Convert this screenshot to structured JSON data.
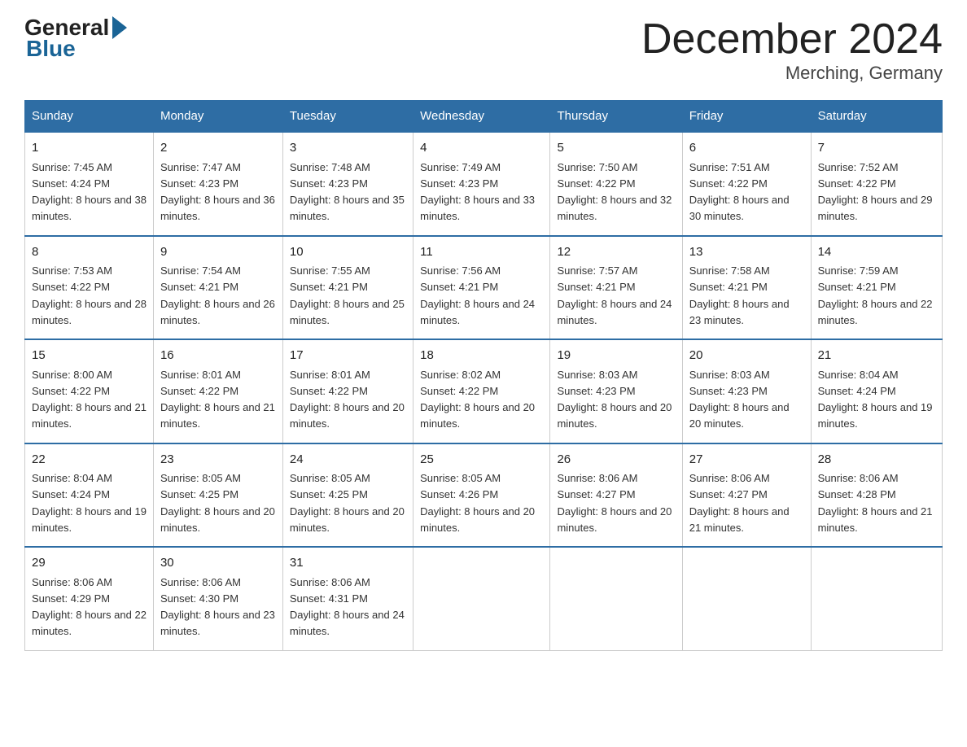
{
  "logo": {
    "general": "General",
    "blue": "Blue"
  },
  "title": "December 2024",
  "subtitle": "Merching, Germany",
  "days_of_week": [
    "Sunday",
    "Monday",
    "Tuesday",
    "Wednesday",
    "Thursday",
    "Friday",
    "Saturday"
  ],
  "weeks": [
    [
      {
        "num": "1",
        "sunrise": "7:45 AM",
        "sunset": "4:24 PM",
        "daylight": "8 hours and 38 minutes."
      },
      {
        "num": "2",
        "sunrise": "7:47 AM",
        "sunset": "4:23 PM",
        "daylight": "8 hours and 36 minutes."
      },
      {
        "num": "3",
        "sunrise": "7:48 AM",
        "sunset": "4:23 PM",
        "daylight": "8 hours and 35 minutes."
      },
      {
        "num": "4",
        "sunrise": "7:49 AM",
        "sunset": "4:23 PM",
        "daylight": "8 hours and 33 minutes."
      },
      {
        "num": "5",
        "sunrise": "7:50 AM",
        "sunset": "4:22 PM",
        "daylight": "8 hours and 32 minutes."
      },
      {
        "num": "6",
        "sunrise": "7:51 AM",
        "sunset": "4:22 PM",
        "daylight": "8 hours and 30 minutes."
      },
      {
        "num": "7",
        "sunrise": "7:52 AM",
        "sunset": "4:22 PM",
        "daylight": "8 hours and 29 minutes."
      }
    ],
    [
      {
        "num": "8",
        "sunrise": "7:53 AM",
        "sunset": "4:22 PM",
        "daylight": "8 hours and 28 minutes."
      },
      {
        "num": "9",
        "sunrise": "7:54 AM",
        "sunset": "4:21 PM",
        "daylight": "8 hours and 26 minutes."
      },
      {
        "num": "10",
        "sunrise": "7:55 AM",
        "sunset": "4:21 PM",
        "daylight": "8 hours and 25 minutes."
      },
      {
        "num": "11",
        "sunrise": "7:56 AM",
        "sunset": "4:21 PM",
        "daylight": "8 hours and 24 minutes."
      },
      {
        "num": "12",
        "sunrise": "7:57 AM",
        "sunset": "4:21 PM",
        "daylight": "8 hours and 24 minutes."
      },
      {
        "num": "13",
        "sunrise": "7:58 AM",
        "sunset": "4:21 PM",
        "daylight": "8 hours and 23 minutes."
      },
      {
        "num": "14",
        "sunrise": "7:59 AM",
        "sunset": "4:21 PM",
        "daylight": "8 hours and 22 minutes."
      }
    ],
    [
      {
        "num": "15",
        "sunrise": "8:00 AM",
        "sunset": "4:22 PM",
        "daylight": "8 hours and 21 minutes."
      },
      {
        "num": "16",
        "sunrise": "8:01 AM",
        "sunset": "4:22 PM",
        "daylight": "8 hours and 21 minutes."
      },
      {
        "num": "17",
        "sunrise": "8:01 AM",
        "sunset": "4:22 PM",
        "daylight": "8 hours and 20 minutes."
      },
      {
        "num": "18",
        "sunrise": "8:02 AM",
        "sunset": "4:22 PM",
        "daylight": "8 hours and 20 minutes."
      },
      {
        "num": "19",
        "sunrise": "8:03 AM",
        "sunset": "4:23 PM",
        "daylight": "8 hours and 20 minutes."
      },
      {
        "num": "20",
        "sunrise": "8:03 AM",
        "sunset": "4:23 PM",
        "daylight": "8 hours and 20 minutes."
      },
      {
        "num": "21",
        "sunrise": "8:04 AM",
        "sunset": "4:24 PM",
        "daylight": "8 hours and 19 minutes."
      }
    ],
    [
      {
        "num": "22",
        "sunrise": "8:04 AM",
        "sunset": "4:24 PM",
        "daylight": "8 hours and 19 minutes."
      },
      {
        "num": "23",
        "sunrise": "8:05 AM",
        "sunset": "4:25 PM",
        "daylight": "8 hours and 20 minutes."
      },
      {
        "num": "24",
        "sunrise": "8:05 AM",
        "sunset": "4:25 PM",
        "daylight": "8 hours and 20 minutes."
      },
      {
        "num": "25",
        "sunrise": "8:05 AM",
        "sunset": "4:26 PM",
        "daylight": "8 hours and 20 minutes."
      },
      {
        "num": "26",
        "sunrise": "8:06 AM",
        "sunset": "4:27 PM",
        "daylight": "8 hours and 20 minutes."
      },
      {
        "num": "27",
        "sunrise": "8:06 AM",
        "sunset": "4:27 PM",
        "daylight": "8 hours and 21 minutes."
      },
      {
        "num": "28",
        "sunrise": "8:06 AM",
        "sunset": "4:28 PM",
        "daylight": "8 hours and 21 minutes."
      }
    ],
    [
      {
        "num": "29",
        "sunrise": "8:06 AM",
        "sunset": "4:29 PM",
        "daylight": "8 hours and 22 minutes."
      },
      {
        "num": "30",
        "sunrise": "8:06 AM",
        "sunset": "4:30 PM",
        "daylight": "8 hours and 23 minutes."
      },
      {
        "num": "31",
        "sunrise": "8:06 AM",
        "sunset": "4:31 PM",
        "daylight": "8 hours and 24 minutes."
      },
      null,
      null,
      null,
      null
    ]
  ],
  "labels": {
    "sunrise": "Sunrise:",
    "sunset": "Sunset:",
    "daylight": "Daylight:"
  }
}
